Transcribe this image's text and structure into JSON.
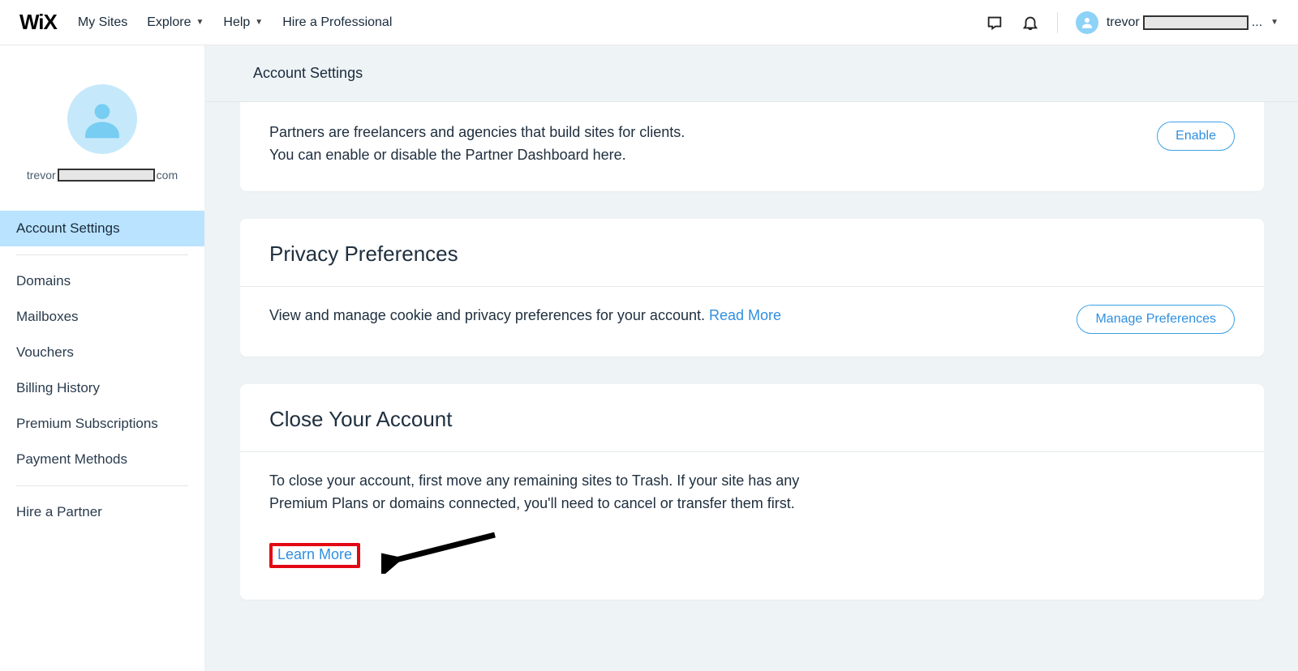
{
  "topnav": {
    "logo_text": "WiX",
    "my_sites": "My Sites",
    "explore": "Explore",
    "help": "Help",
    "hire": "Hire a Professional",
    "user_prefix": "trevor",
    "user_suffix": "..."
  },
  "sidebar": {
    "email_prefix": "trevor",
    "email_suffix": "com",
    "items": {
      "account_settings": "Account Settings",
      "domains": "Domains",
      "mailboxes": "Mailboxes",
      "vouchers": "Vouchers",
      "billing": "Billing History",
      "premium": "Premium Subscriptions",
      "payment": "Payment Methods",
      "hire_partner": "Hire a Partner"
    }
  },
  "page_title": "Account Settings",
  "partners": {
    "line1": "Partners are freelancers and agencies that build sites for clients.",
    "line2": "You can enable or disable the Partner Dashboard here.",
    "button": "Enable"
  },
  "privacy": {
    "title": "Privacy Preferences",
    "text": "View and manage cookie and privacy preferences for your account.  ",
    "read_more": "Read More",
    "button": "Manage Preferences"
  },
  "close_account": {
    "title": "Close Your Account",
    "text": "To close your account, first move any remaining sites to Trash. If your site has any Premium Plans or domains connected, you'll need to cancel or transfer them first.",
    "learn_more": "Learn More"
  }
}
